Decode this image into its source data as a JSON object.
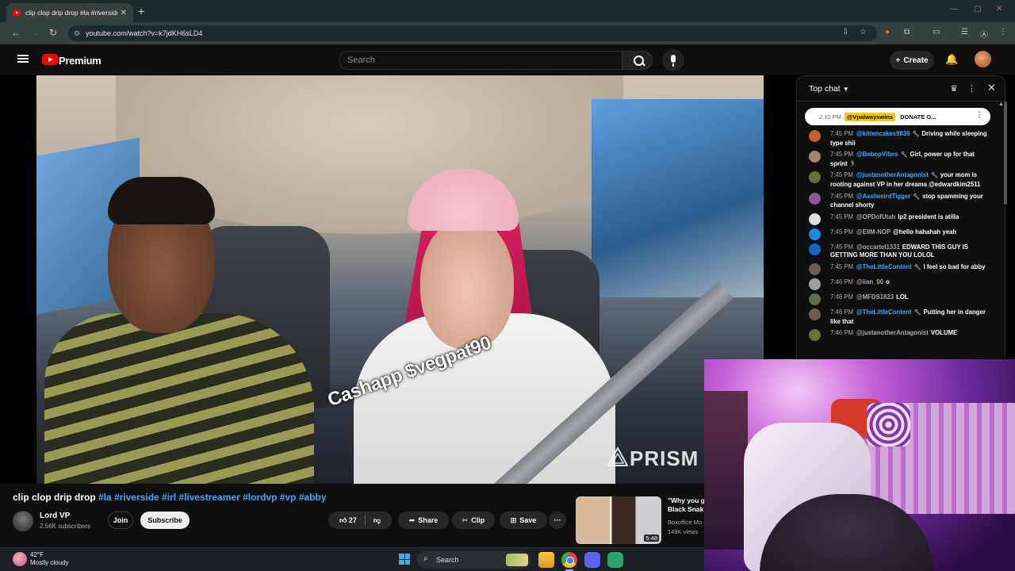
{
  "browser": {
    "tab_title": "clip clop drip drop #la #riverside",
    "url": "youtube.com/watch?v=k7jdKH6sLD4"
  },
  "youtube": {
    "logo_text": "Premium",
    "search_placeholder": "Search",
    "create_label": "Create"
  },
  "video": {
    "overlay_text": "Cashapp $vegpat90",
    "watermark_text": "PRISM"
  },
  "meta": {
    "title_plain": "clip clop drip drop ",
    "title_tags": "#la #riverside #irl #livestreamer #lordvp #vp #abby",
    "channel_name": "Lord VP",
    "subscribers": "2.56K subscribers",
    "join_label": "Join",
    "subscribe_label": "Subscribe",
    "like_count": "27",
    "share_label": "Share",
    "clip_label": "Clip",
    "save_label": "Save",
    "rec": {
      "title_line1": "\"Why you g",
      "title_line2": "Black Snak",
      "channel": "Boxoffice Mo",
      "views": "149K views ·",
      "duration": "5:48"
    }
  },
  "chat": {
    "title": "Top chat",
    "pinned": {
      "time": "2:10 PM",
      "author": "@Vpalwayswins",
      "text": "DONATE O..."
    },
    "messages": [
      {
        "time": "7:45 PM",
        "author": "@kittencakes9836",
        "member": true,
        "text": "Driving while sleeping type shii",
        "avatar": "#c0612f"
      },
      {
        "time": "7:45 PM",
        "author": "@BebopVibes",
        "member": true,
        "text": "Girl, power up for that sprint 🏃",
        "avatar": "#a97e73"
      },
      {
        "time": "7:45 PM",
        "author": "@justanotherAntagonist",
        "member": true,
        "text": "your mom is rooting against VP in her dreams @edwardkim2511",
        "avatar": "#6b6f3d"
      },
      {
        "time": "7:45 PM",
        "author": "@AxelweirdTigger",
        "member": true,
        "text": "stop spamming your channel shorty",
        "avatar": "#8a5a8f"
      },
      {
        "time": "7:45 PM",
        "author": "@OPDofUtah",
        "member": false,
        "text": "lp2 president is atilla",
        "avatar": "#dddddd"
      },
      {
        "time": "7:45 PM",
        "author": "@EllM-NOP",
        "member": false,
        "text": "@hello hahahah yeah",
        "avatar": "#1e88e5"
      },
      {
        "time": "7:45 PM",
        "author": "@occartel1331",
        "member": false,
        "text": "EDWARD THIS GUY IS GETTING MORE THAN YOU LOLOL",
        "avatar": "#1565c0"
      },
      {
        "time": "7:45 PM",
        "author": "@TheLittleContent",
        "member": true,
        "text": "I feel so bad for abby",
        "avatar": "#6b5c52"
      },
      {
        "time": "7:46 PM",
        "author": "@iian_00",
        "member": false,
        "text": "o",
        "avatar": "#9e9e9e"
      },
      {
        "time": "7:46 PM",
        "author": "@MFDS1623",
        "member": false,
        "text": "LOL",
        "avatar": "#5d6b4f"
      },
      {
        "time": "7:46 PM",
        "author": "@TheLittleContent",
        "member": true,
        "text": "Putting her in danger like that",
        "avatar": "#6b5c52"
      },
      {
        "time": "7:46 PM",
        "author": "@justanotherAntagonist",
        "member": false,
        "text": "VOLUME",
        "avatar": "#6b6f3d"
      }
    ]
  },
  "taskbar": {
    "temperature": "42°F",
    "weather": "Mostly cloudy",
    "search_label": "Search"
  }
}
